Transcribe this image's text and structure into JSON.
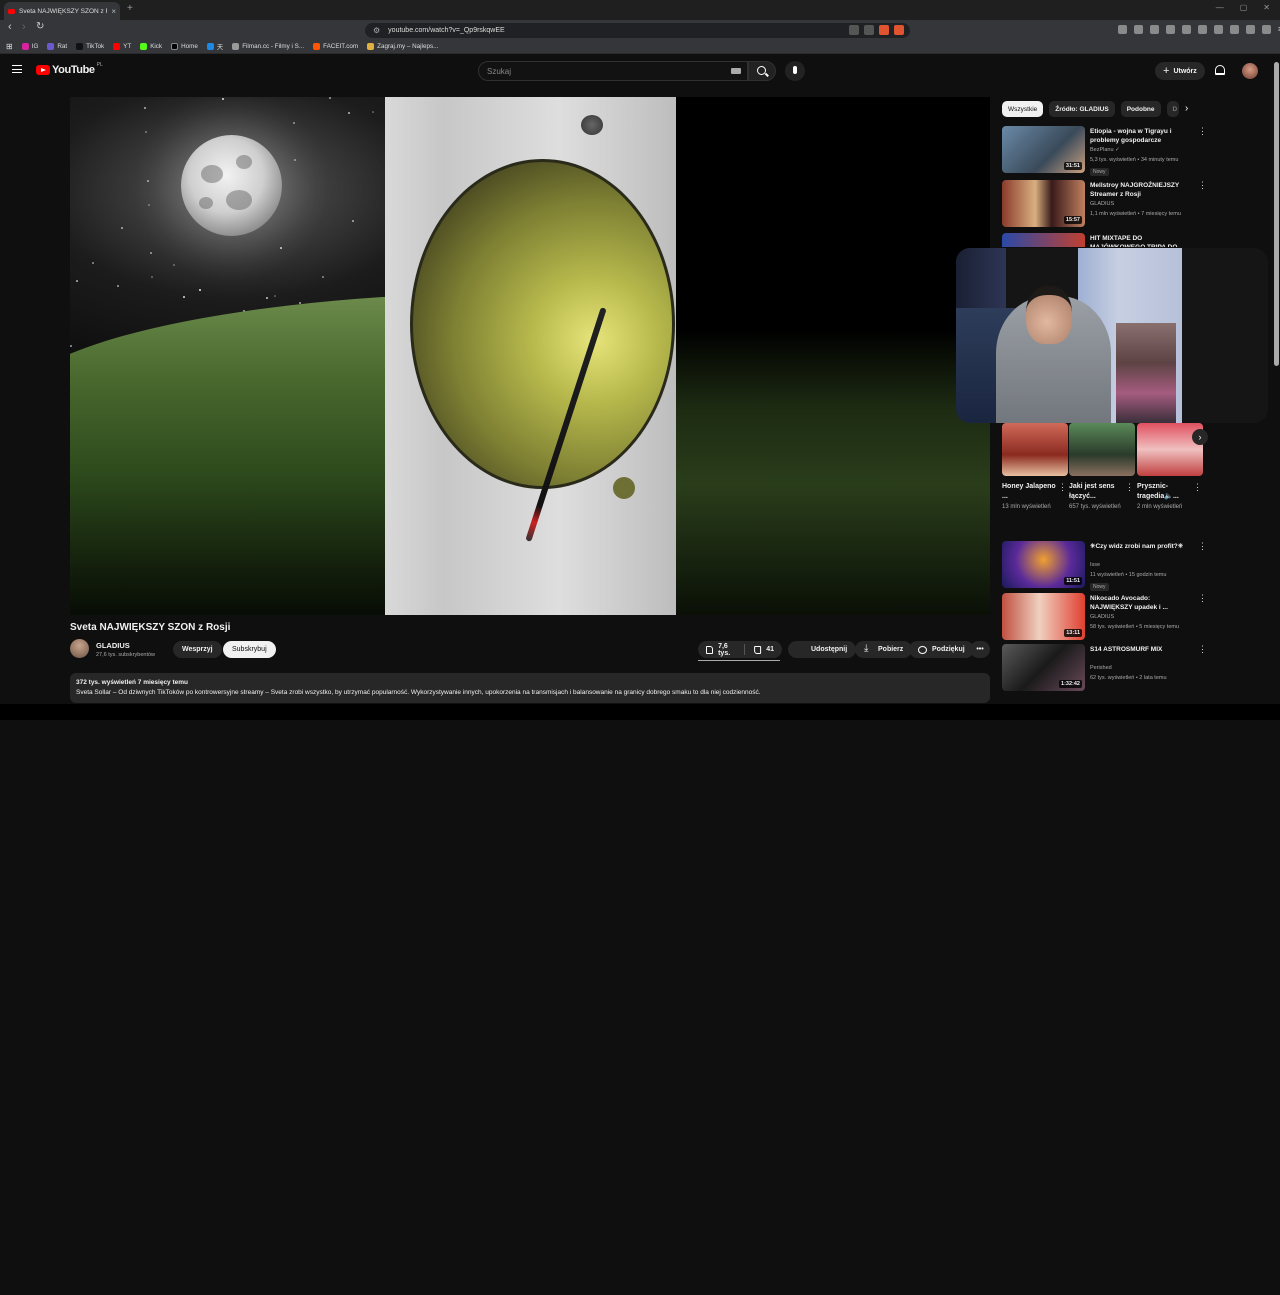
{
  "browser": {
    "tab_title": "Sveta NAJWIĘKSZY SZON z R",
    "tab_close": "×",
    "new_tab": "+",
    "url": "youtube.com/watch?v=_Qp9rskqwEE",
    "url_tune_icon": "⚙",
    "window_controls": [
      "—",
      "▢",
      "✕"
    ]
  },
  "bookmarks": [
    {
      "label": "IG",
      "color": "#d6249f"
    },
    {
      "label": "Rat",
      "color": "#6a5acd"
    },
    {
      "label": "TikTok",
      "color": "#111111"
    },
    {
      "label": "YT",
      "color": "#ff0000"
    },
    {
      "label": "Kick",
      "color": "#53fc18"
    },
    {
      "label": "Home",
      "color": "#000000"
    },
    {
      "label": "天",
      "color": "#1e88e5"
    },
    {
      "label": "Filman.cc - Filmy i S...",
      "color": "#999999"
    },
    {
      "label": "FACEIT.com",
      "color": "#ff5500"
    },
    {
      "label": "Zagraj.my – Najleps...",
      "color": "#e0b040"
    }
  ],
  "youtube": {
    "logo_text": "YouTube",
    "logo_region": "PL",
    "search_placeholder": "Szukaj",
    "create_label": "Utwórz",
    "create_icon": "+"
  },
  "video": {
    "title": "Sveta NAJWIĘKSZY SZON z Rosji",
    "channel": "GLADIUS",
    "subscribers": "27,6 tys. subskrybentów",
    "support_label": "Wesprzyj",
    "subscribe_label": "Subskrybuj",
    "likes": "7,6 tys.",
    "dislikes": "41",
    "share_label": "Udostępnij",
    "download_label": "Pobierz",
    "thanks_label": "Podziękuj",
    "more_label": "•••",
    "stats": "372 tys. wyświetleń  7 miesięcy temu",
    "description": "Sveta Sollar – Od dziwnych TikToków po kontrowersyjne streamy – Sveta zrobi wszystko, by utrzymać popularność. Wykorzystywanie innych, upokorzenia na transmisjach i balansowanie na granicy dobrego smaku to dla niej codzienność."
  },
  "chips": [
    {
      "label": "Wszystkie",
      "active": true
    },
    {
      "label": "Źródło: GLADIUS",
      "active": false
    },
    {
      "label": "Podobne",
      "active": false
    },
    {
      "label": "D",
      "active": false
    }
  ],
  "chip_arrow": "›",
  "recommendations_top": [
    {
      "title": "Etiopia - wojna w Tigrayu i problemy gospodarcze",
      "channel": "BezPlanu ✓",
      "meta": "5,3 tys. wyświetleń • 34 minuty temu",
      "badge": "Nowy",
      "duration": "31:51",
      "thumb": "#4a6a8a"
    },
    {
      "title": "Mellstroy NAJGROŹNIEJSZY Streamer z Rosji",
      "channel": "GLADIUS",
      "meta": "1,1 mln wyświetleń • 7 miesięcy temu",
      "badge": "",
      "duration": "15:57",
      "thumb": "#7a2a2a"
    },
    {
      "title": "HIT MIXTAPE DO MAJÓWKOWEGO TRIPA DO",
      "channel": "",
      "meta": "",
      "badge": "",
      "duration": "",
      "thumb": "#2a4a9a"
    }
  ],
  "shorts": [
    {
      "title": "Honey Jalapeno ...",
      "views": "13 mln wyświetleń",
      "thumb": "#a04a3a",
      "dots": "⋮"
    },
    {
      "title": "Jaki jest sens łączyć...",
      "views": "657 tys. wyświetleń",
      "thumb": "#3a5a3a",
      "dots": "⋮"
    },
    {
      "title": "Prysznic-tragedia🔈...",
      "views": "2 mln wyświetleń",
      "thumb": "#c04050",
      "dots": "⋮"
    }
  ],
  "shorts_arrow": "›",
  "recommendations_bottom": [
    {
      "title": "✳Czy widz zrobi nam profit?✳",
      "channel": "Isse",
      "meta": "11 wyświetleń • 15 godzin temu",
      "badge": "Nowy",
      "duration": "11:51",
      "thumb": "#3a2a8a"
    },
    {
      "title": "Nikocado Avocado: NAJWIĘKSZY upadek i ...",
      "channel": "GLADIUS",
      "meta": "58 tys. wyświetleń • 5 miesięcy temu",
      "badge": "",
      "duration": "13:11",
      "thumb": "#d84a3a"
    },
    {
      "title": "S14 ASTROSMURF MIX",
      "channel": "Perished",
      "meta": "62 tys. wyświetleń • 2 lata temu",
      "badge": "",
      "duration": "1:32:42",
      "thumb": "#3a3a3a"
    }
  ],
  "rec_more": "⋮"
}
